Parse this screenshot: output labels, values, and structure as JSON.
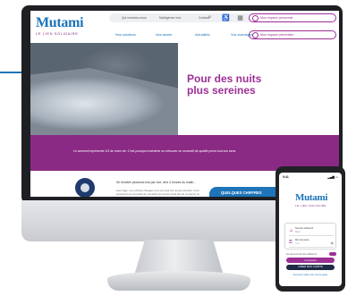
{
  "colors": {
    "brand_blue": "#1d74b8",
    "brand_purple": "#9d2f95",
    "band_purple": "#8a2a85",
    "dark_navy": "#1f2a44"
  },
  "brand": {
    "name": "Mutami",
    "tagline": "LE LIEN SOLIDAIRE"
  },
  "topbar": {
    "links": [
      "Qui sommes-nous",
      "Ma/Agence mut.",
      "Contact"
    ],
    "icons": [
      "search-icon",
      "accessibility-icon",
      "calendar-icon"
    ],
    "personal_space": "Mon espace personnel",
    "prevention_space": "Mon espace prévention"
  },
  "nav": {
    "items": [
      "Nos solutions",
      "Nos atouts",
      "Actualités",
      "Vos avantages"
    ]
  },
  "hero": {
    "title": "Pour des nuits plus sereines",
    "band_text": "Le sommeil représente 1/3 de notre vie. C'est pourquoi maintenir ou retrouver un sommeil de qualité prend tout son sens."
  },
  "info": {
    "title": "Se réveiller plusieurs fois par nuit, vers 4 heures du matin...",
    "body": "Avec l'âge, nos rythmes changent et le sommeil s'en trouve perturbé. C'est pourquoi il est important de connaître les bonnes clefs afin de conserver un sommeil de qualité.",
    "figures_label": "QUELQUES CHIFFRES"
  },
  "phone": {
    "time": "9:41",
    "signal": "▂▄▆ ▭",
    "username_label": "Numéro adhérent",
    "username_value": "Nom",
    "password_label": "Mot de passe",
    "password_value": "•••••",
    "remember": "Se souvenir de mon adhérent",
    "login": "Connexion",
    "signup": "CRÉER MON COMPTE",
    "footer": "Vous avez oublié votre mot de passe"
  }
}
